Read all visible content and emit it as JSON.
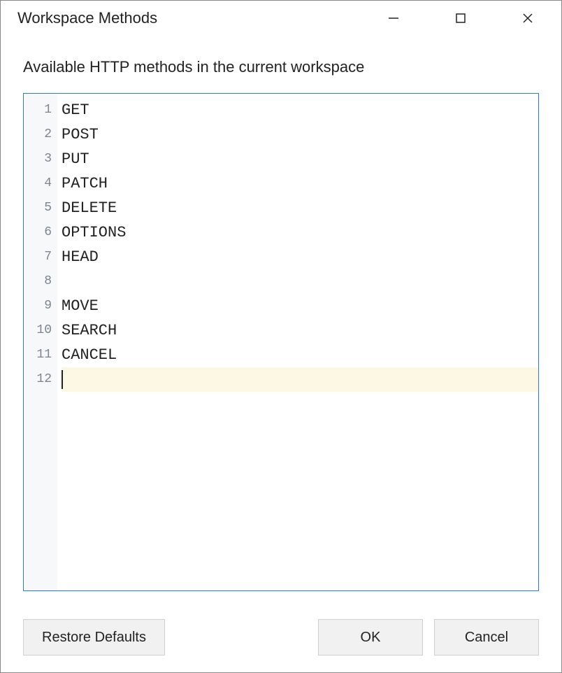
{
  "titlebar": {
    "title": "Workspace Methods"
  },
  "content": {
    "subtitle": "Available HTTP methods in the current workspace"
  },
  "editor": {
    "lines": [
      "GET",
      "POST",
      "PUT",
      "PATCH",
      "DELETE",
      "OPTIONS",
      "HEAD",
      "",
      "MOVE",
      "SEARCH",
      "CANCEL",
      ""
    ],
    "current_line_index": 11
  },
  "buttons": {
    "restore_defaults": "Restore Defaults",
    "ok": "OK",
    "cancel": "Cancel"
  }
}
